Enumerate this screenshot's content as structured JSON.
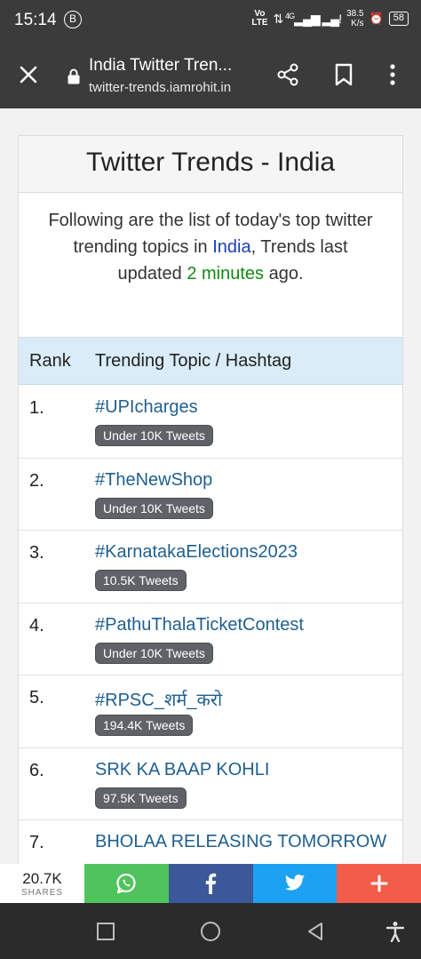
{
  "status": {
    "time": "15:14",
    "b_icon": "B",
    "network_top": "Vo",
    "network_bottom": "LTE",
    "net_4g": "4G",
    "signal": "↑↓ .❘❘ .❘! ",
    "speed_top": "38.5",
    "speed_bottom": "K/s",
    "battery": "58"
  },
  "toolbar": {
    "title": "India Twitter Tren...",
    "url": "twitter-trends.iamrohit.in"
  },
  "page": {
    "title": "Twitter Trends - India",
    "intro_line1": "Following are the list of today's top twitter",
    "intro_line2_pre": "trending topics in ",
    "intro_country": "India",
    "intro_line2_post": ", Trends last",
    "intro_line3_pre": "updated ",
    "intro_updated": "2 minutes",
    "intro_line3_post": " ago."
  },
  "table": {
    "col_rank": "Rank",
    "col_topic": "Trending Topic / Hashtag",
    "rows": [
      {
        "rank": "1.",
        "topic": "#UPIcharges",
        "tweets": "Under 10K Tweets"
      },
      {
        "rank": "2.",
        "topic": "#TheNewShop",
        "tweets": "Under 10K Tweets"
      },
      {
        "rank": "3.",
        "topic": "#KarnatakaElections2023",
        "tweets": "10.5K Tweets"
      },
      {
        "rank": "4.",
        "topic": "#PathuThalaTicketContest",
        "tweets": "Under 10K Tweets"
      },
      {
        "rank": "5.",
        "topic": "#RPSC_शर्म_करो",
        "tweets": "194.4K Tweets"
      },
      {
        "rank": "6.",
        "topic": "SRK KA BAAP KOHLI",
        "tweets": "97.5K Tweets"
      },
      {
        "rank": "7.",
        "topic": "BHOLAA RELEASING TOMORROW",
        "tweets": ""
      }
    ]
  },
  "sharebar": {
    "count": "20.7K",
    "label": "SHARES",
    "colors": {
      "whatsapp": "#4fc45c",
      "facebook": "#3b5998",
      "twitter": "#1da1f2",
      "plus": "#f45c4a"
    }
  },
  "icons": [
    "close-icon",
    "lock-icon",
    "share-icon",
    "bookmark-icon",
    "more-vertical-icon",
    "whatsapp-icon",
    "facebook-icon",
    "twitter-icon",
    "plus-icon",
    "recents-icon",
    "home-icon",
    "back-icon",
    "accessibility-icon"
  ]
}
